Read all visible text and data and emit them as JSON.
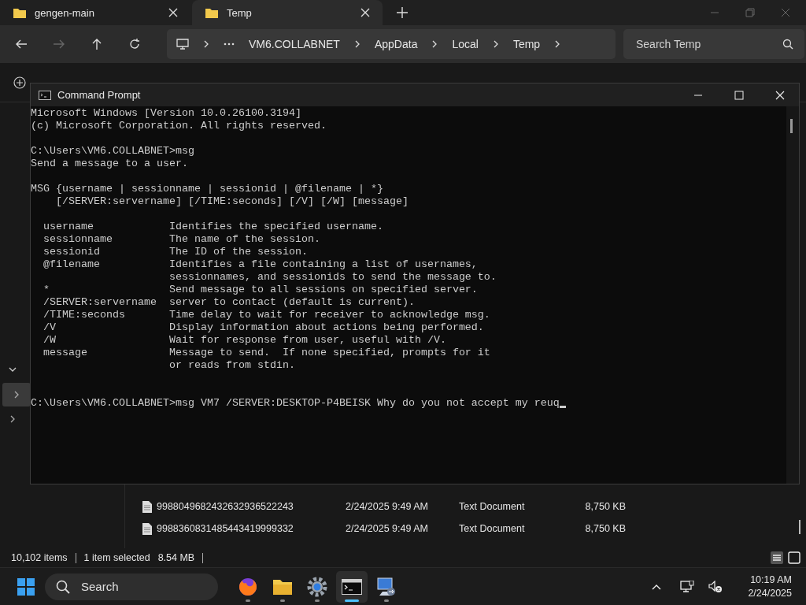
{
  "explorer": {
    "tabs": [
      {
        "label": "gengen-main",
        "selected": false
      },
      {
        "label": "Temp",
        "selected": true
      }
    ],
    "breadcrumb": [
      "VM6.COLLABNET",
      "AppData",
      "Local",
      "Temp"
    ],
    "search": {
      "placeholder": "Search Temp"
    },
    "files": [
      {
        "name": "9988049682432632936522243",
        "date": "2/24/2025 9:49 AM",
        "type": "Text Document",
        "size": "8,750 KB",
        "selected": false
      },
      {
        "name": "9988360831485443419999332",
        "date": "2/24/2025 9:49 AM",
        "type": "Text Document",
        "size": "8,750 KB",
        "selected": false
      }
    ],
    "status_bar": {
      "items": "10,102 items",
      "selection": "1 item selected",
      "size": "8.54 MB"
    }
  },
  "console": {
    "title": "Command Prompt",
    "blocks": [
      [
        "Microsoft Windows [Version 10.0.26100.3194]",
        "(c) Microsoft Corporation. All rights reserved."
      ],
      [
        "C:\\Users\\VM6.COLLABNET>msg",
        "Send a message to a user."
      ],
      [
        "MSG {username | sessionname | sessionid | @filename | *}",
        "    [/SERVER:servername] [/TIME:seconds] [/V] [/W] [message]"
      ],
      [
        "  username            Identifies the specified username.",
        "  sessionname         The name of the session.",
        "  sessionid           The ID of the session.",
        "  @filename           Identifies a file containing a list of usernames,",
        "                      sessionnames, and sessionids to send the message to.",
        "  *                   Send message to all sessions on specified server.",
        "  /SERVER:servername  server to contact (default is current).",
        "  /TIME:seconds       Time delay to wait for receiver to acknowledge msg.",
        "  /V                  Display information about actions being performed.",
        "  /W                  Wait for response from user, useful with /V.",
        "  message             Message to send.  If none specified, prompts for it",
        "                      or reads from stdin."
      ],
      [
        "C:\\Users\\VM6.COLLABNET>msg VM7 /SERVER:DESKTOP-P4BEISK Why do you not accept my reuq"
      ]
    ]
  },
  "taskbar": {
    "search": {
      "placeholder": "Search"
    },
    "apps": [
      {
        "kind": "browser",
        "selected": false
      },
      {
        "kind": "folder",
        "selected": false
      },
      {
        "kind": "gear",
        "selected": false
      },
      {
        "kind": "terminal",
        "selected": true
      },
      {
        "kind": "remote",
        "selected": false
      }
    ],
    "time": "10:19 AM",
    "date": "2/24/2025"
  }
}
